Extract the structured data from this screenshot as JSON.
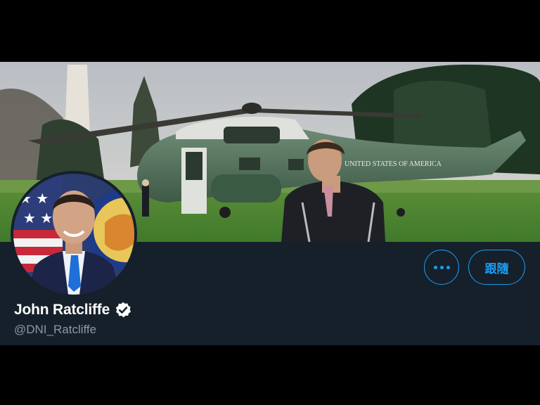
{
  "profile": {
    "display_name": "John Ratcliffe",
    "handle": "@DNI_Ratcliffe",
    "verified": true
  },
  "banner": {
    "helicopter_text": "UNITED STATES OF AMERICA"
  },
  "actions": {
    "more_icon": "more-horizontal-icon",
    "follow_label": "跟隨"
  },
  "colors": {
    "background": "#15202b",
    "accent": "#1d9bf0",
    "handle_text": "#8b98a5",
    "name_text": "#ffffff"
  }
}
